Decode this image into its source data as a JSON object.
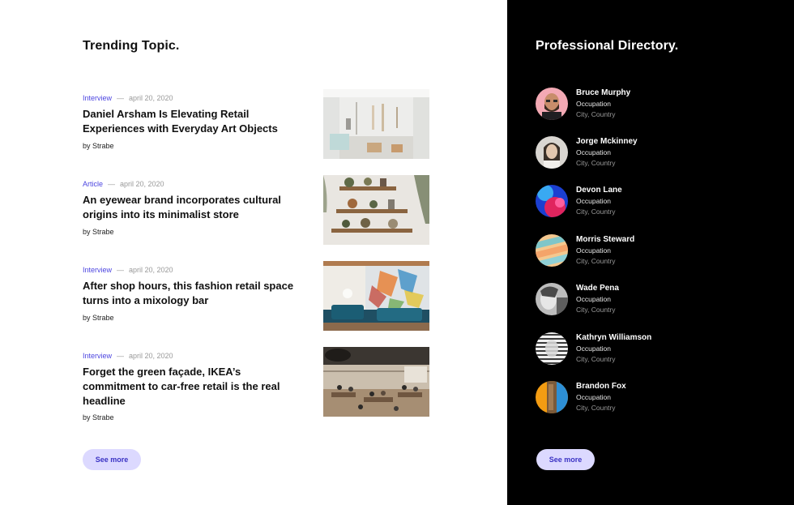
{
  "trending": {
    "title": "Trending Topic.",
    "see_more_label": "See more",
    "articles": [
      {
        "category": "Interview",
        "date": "april 20, 2020",
        "headline": "Daniel Arsham Is Elevating Retail Experiences with Everyday Art Objects",
        "byline": "by Strabe",
        "image": "white-gallery-store-photo"
      },
      {
        "category": "Article",
        "date": "april 20, 2020",
        "headline": "An eyewear brand incorporates cultural origins into its minimalist store",
        "byline": "by Strabe",
        "image": "wall-shelves-with-plants-photo"
      },
      {
        "category": "Interview",
        "date": "april 20, 2020",
        "headline": "After shop hours, this fashion retail space turns into a mixology bar",
        "byline": "by Strabe",
        "image": "stained-glass-lounge-photo"
      },
      {
        "category": "Interview",
        "date": "april 20, 2020",
        "headline": "Forget the green façade, IKEA’s commitment to car-free retail is the real headline",
        "byline": "by Strabe",
        "image": "busy-cafe-interior-photo"
      }
    ],
    "separator": "—"
  },
  "directory": {
    "title": "Professional Directory.",
    "see_more_label": "See more",
    "people": [
      {
        "name": "Bruce Murphy",
        "occupation": "Occupation",
        "location": "City, Country",
        "avatar": "bearded-man-avatar"
      },
      {
        "name": "Jorge Mckinney",
        "occupation": "Occupation",
        "location": "City, Country",
        "avatar": "woman-portrait-avatar"
      },
      {
        "name": "Devon Lane",
        "occupation": "Occupation",
        "location": "City, Country",
        "avatar": "blue-pink-abstract-avatar"
      },
      {
        "name": "Morris Steward",
        "occupation": "Occupation",
        "location": "City, Country",
        "avatar": "pastel-stripes-avatar"
      },
      {
        "name": "Wade Pena",
        "occupation": "Occupation",
        "location": "City, Country",
        "avatar": "monochrome-portrait-avatar"
      },
      {
        "name": "Kathryn Williamson",
        "occupation": "Occupation",
        "location": "City, Country",
        "avatar": "striped-portrait-avatar"
      },
      {
        "name": "Brandon Fox",
        "occupation": "Occupation",
        "location": "City, Country",
        "avatar": "orange-blue-avatar"
      }
    ]
  },
  "colors": {
    "accent": "#4c45e0",
    "button_bg": "#dcd9ff",
    "dark_panel": "#000000"
  }
}
